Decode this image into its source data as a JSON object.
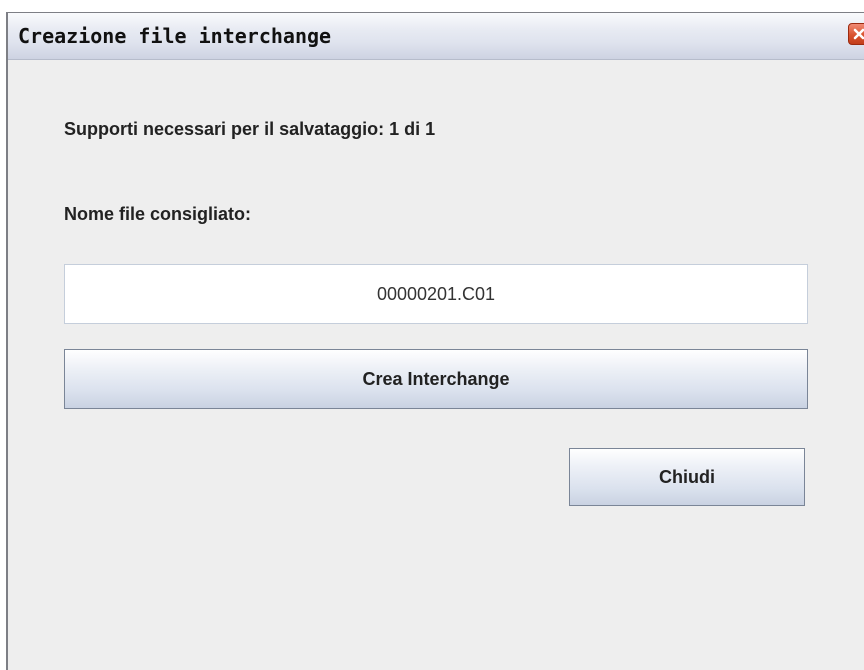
{
  "window": {
    "title": "Creazione file interchange"
  },
  "icons": {
    "close": "close-icon"
  },
  "colors": {
    "close_button": "#d9532f",
    "window_background": "#eeeeee"
  },
  "content": {
    "supporti_label": "Supporti necessari per il salvataggio: 1 di 1",
    "nome_file_label": "Nome file consigliato:",
    "filename_value": "00000201.C01"
  },
  "buttons": {
    "crea_label": "Crea Interchange",
    "chiudi_label": "Chiudi"
  }
}
